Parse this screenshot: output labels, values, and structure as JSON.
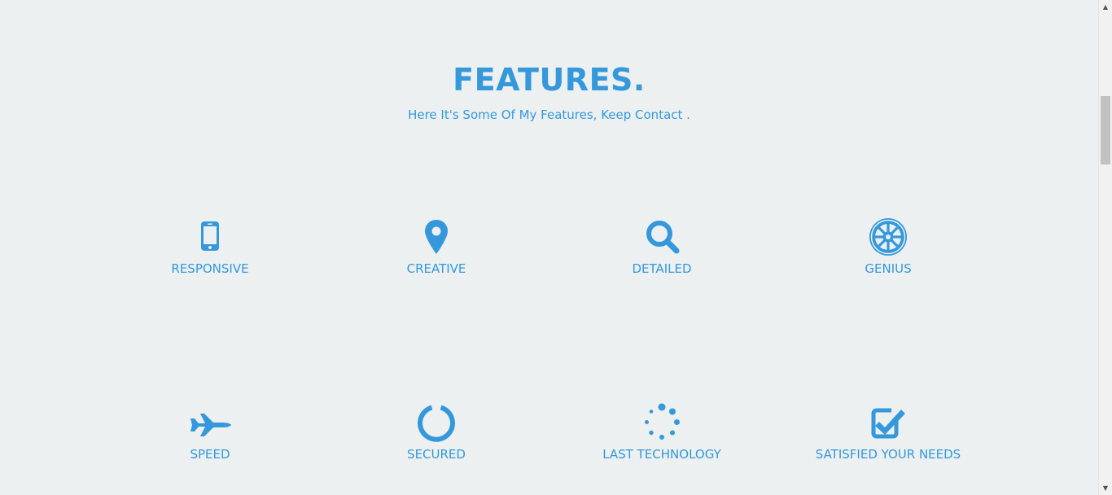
{
  "section": {
    "title": "FEATURES.",
    "subtitle": "Here It's Some Of My Features, Keep Contact ."
  },
  "features": [
    {
      "label": "RESPONSIVE",
      "icon": "mobile-phone-icon"
    },
    {
      "label": "CREATIVE",
      "icon": "map-marker-icon"
    },
    {
      "label": "DETAILED",
      "icon": "search-icon"
    },
    {
      "label": "GENIUS",
      "icon": "galactic-empire-icon"
    },
    {
      "label": "SPEED",
      "icon": "fighter-jet-icon"
    },
    {
      "label": "SECURED",
      "icon": "circle-notch-icon"
    },
    {
      "label": "LAST TECHNOLOGY",
      "icon": "spinner-icon"
    },
    {
      "label": "SATISFIED YOUR NEEDS",
      "icon": "check-square-icon"
    }
  ],
  "colors": {
    "accent": "#3498db",
    "background": "#ecf0f1"
  }
}
